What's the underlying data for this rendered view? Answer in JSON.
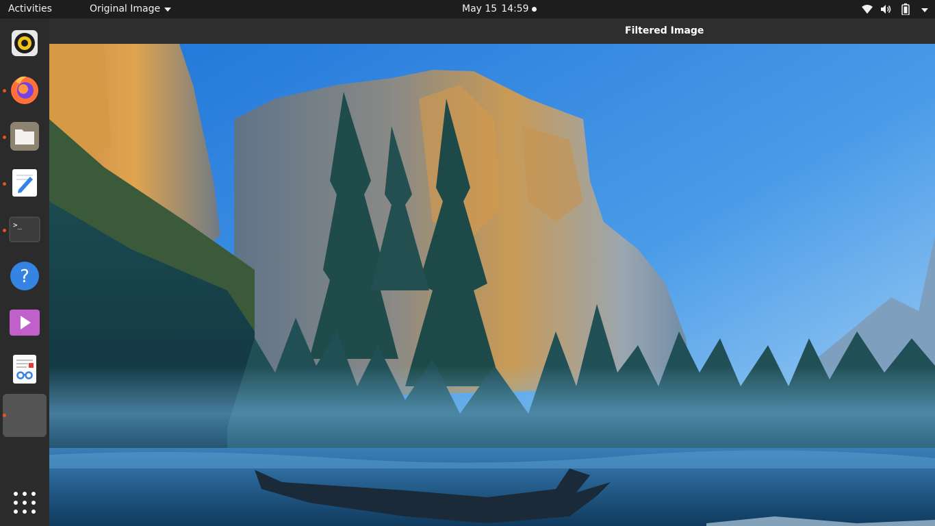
{
  "topbar": {
    "activities_label": "Activities",
    "app_menu_label": "Original Image",
    "clock_date": "May 15",
    "clock_time": "14:59"
  },
  "system_tray": {
    "icons": [
      "wifi-icon",
      "volume-icon",
      "battery-icon"
    ]
  },
  "dock": {
    "items": [
      {
        "name": "rhythmbox",
        "icon": "rhythmbox-icon",
        "running": false
      },
      {
        "name": "firefox",
        "icon": "firefox-icon",
        "running": true
      },
      {
        "name": "files",
        "icon": "files-icon",
        "running": true
      },
      {
        "name": "text-editor",
        "icon": "text-editor-icon",
        "running": true
      },
      {
        "name": "terminal",
        "icon": "terminal-icon",
        "running": true
      },
      {
        "name": "help",
        "icon": "help-icon",
        "running": false
      },
      {
        "name": "videos",
        "icon": "videos-icon",
        "running": false
      },
      {
        "name": "document-viewer",
        "icon": "document-viewer-icon",
        "running": false
      },
      {
        "name": "active-app",
        "icon": "blank-app-icon",
        "running": true
      }
    ],
    "show_apps_icon": "app-grid-icon"
  },
  "window": {
    "title": "Filtered Image",
    "content": "landscape-photo"
  },
  "colors": {
    "topbar_bg": "#1d1d1d",
    "dock_bg": "#2b2b2b",
    "headerbar_bg": "#2e2e2e",
    "running_indicator": "#e95420"
  }
}
